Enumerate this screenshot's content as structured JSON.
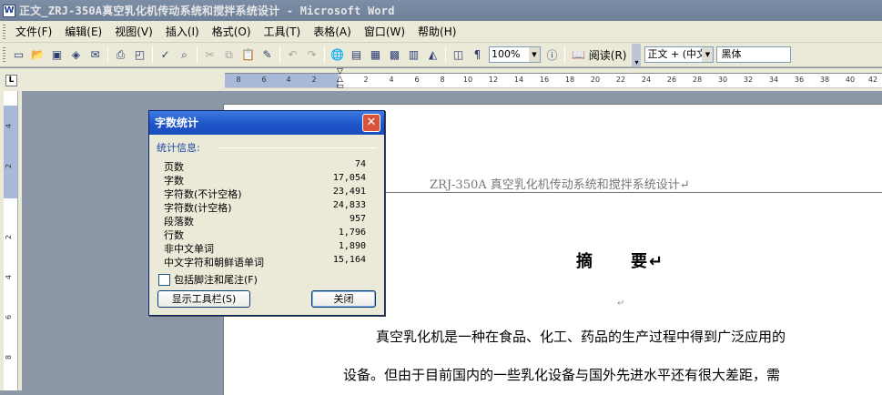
{
  "window": {
    "title": "正文_ZRJ-350A真空乳化机传动系统和搅拌系统设计 - Microsoft Word",
    "app_icon": "W"
  },
  "menu": [
    "文件(F)",
    "编辑(E)",
    "视图(V)",
    "插入(I)",
    "格式(O)",
    "工具(T)",
    "表格(A)",
    "窗口(W)",
    "帮助(H)"
  ],
  "toolbar": {
    "zoom": "100%",
    "read_label": "阅读(R)",
    "style": "正文 + (中文",
    "font": "黑体"
  },
  "ruler": {
    "h_ticks": [
      "8",
      "6",
      "4",
      "2",
      "2",
      "4",
      "6",
      "8",
      "10",
      "12",
      "14",
      "16",
      "18",
      "20",
      "22",
      "24",
      "26",
      "28",
      "30",
      "32",
      "34",
      "36",
      "38",
      "40",
      "42"
    ],
    "v_ticks": [
      "4",
      "2",
      "2",
      "4",
      "6",
      "8"
    ]
  },
  "document": {
    "header": "ZRJ-350A 真空乳化机传动系统和搅拌系统设计↵",
    "title": "摘　　要↵",
    "empty_para": "↵",
    "line1": "真空乳化机是一种在食品、化工、药品的生产过程中得到广泛应用的",
    "line2": "设备。但由于目前国内的一些乳化设备与国外先进水平还有很大差距，需"
  },
  "dialog": {
    "title": "字数统计",
    "group_label": "统计信息:",
    "stats": [
      {
        "label": "页数",
        "value": "74"
      },
      {
        "label": "字数",
        "value": "17,054"
      },
      {
        "label": "字符数(不计空格)",
        "value": "23,491"
      },
      {
        "label": "字符数(计空格)",
        "value": "24,833"
      },
      {
        "label": "段落数",
        "value": "957"
      },
      {
        "label": "行数",
        "value": "1,796"
      },
      {
        "label": "非中文单词",
        "value": "1,890"
      },
      {
        "label": "中文字符和朝鲜语单词",
        "value": "15,164"
      }
    ],
    "checkbox_label": "包括脚注和尾注(F)",
    "checkbox_checked": false,
    "show_toolbar_button": "显示工具栏(S)",
    "close_button": "关闭"
  }
}
